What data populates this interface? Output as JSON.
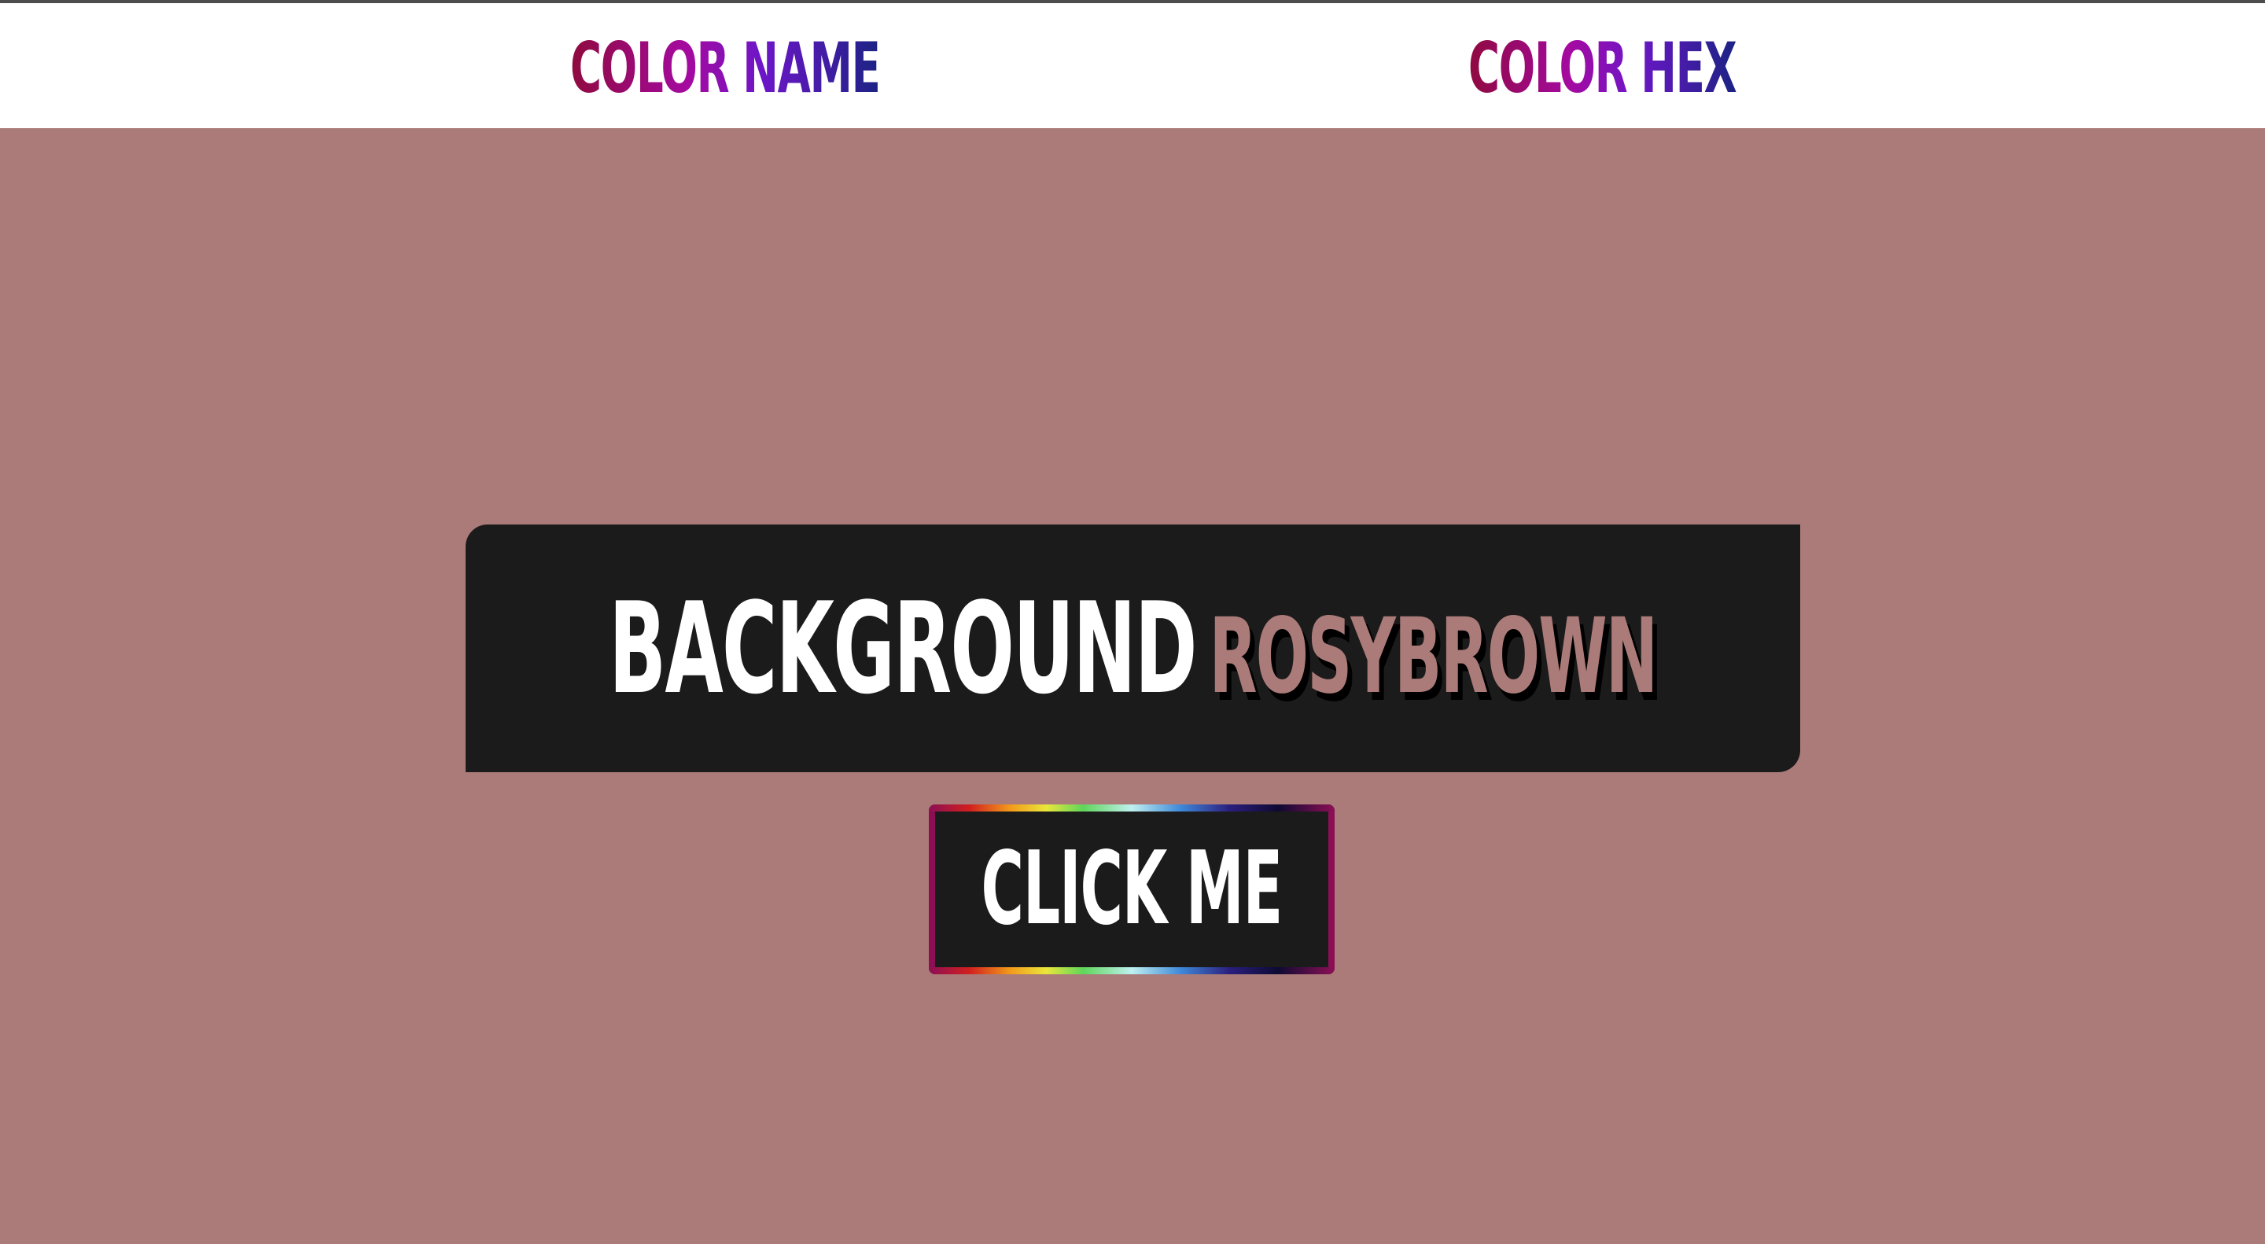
{
  "nav": {
    "color_name_label": "COLOR NAME",
    "color_hex_label": "COLOR HEX"
  },
  "panel": {
    "label": "BACKGROUND",
    "value": "ROSYBROWN"
  },
  "button": {
    "label": "CLICK ME"
  },
  "colors": {
    "background": "#ab7b79",
    "panel": "#1b1b1b",
    "navbar": "#ffffff",
    "top_rule": "#4d4d4d",
    "nav_gradient": [
      "#8f0a3f",
      "#a40aa0",
      "#6d16c8",
      "#1b2384"
    ],
    "button_border_accent": "#8c0f55"
  }
}
